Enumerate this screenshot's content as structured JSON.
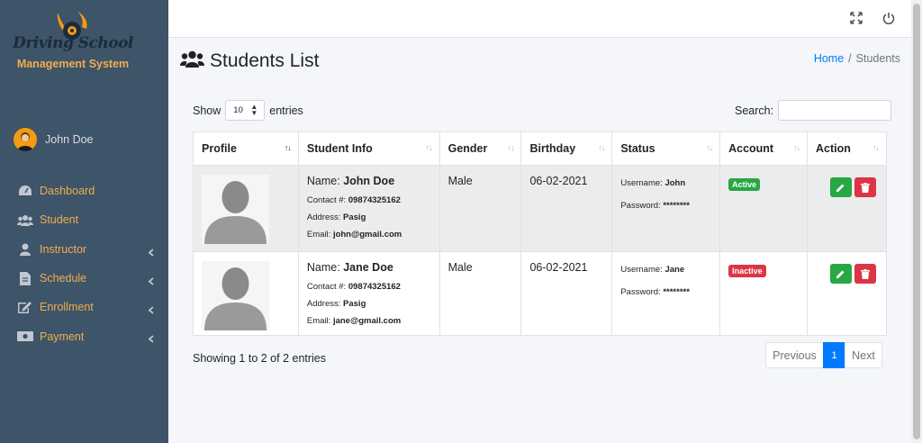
{
  "brand": {
    "title": "Driving School",
    "subtitle": "Management System"
  },
  "user": {
    "name": "John Doe"
  },
  "nav": [
    {
      "label": "Dashboard",
      "icon": "dashboard-icon",
      "has_caret": false
    },
    {
      "label": "Student",
      "icon": "users-icon",
      "has_caret": false
    },
    {
      "label": "Instructor",
      "icon": "user-icon",
      "has_caret": true
    },
    {
      "label": "Schedule",
      "icon": "file-icon",
      "has_caret": true
    },
    {
      "label": "Enrollment",
      "icon": "edit-icon",
      "has_caret": true
    },
    {
      "label": "Payment",
      "icon": "money-icon",
      "has_caret": true
    }
  ],
  "header": {
    "title": "Students List",
    "breadcrumb": {
      "home": "Home",
      "separator": "/",
      "current": "Students"
    }
  },
  "datatable": {
    "show_label": "Show",
    "entries_label": "entries",
    "page_length": "10",
    "search_label": "Search:",
    "search_value": "",
    "columns": [
      "Profile",
      "Student Info",
      "Gender",
      "Birthday",
      "Status",
      "Account",
      "Action"
    ],
    "rows": [
      {
        "name_label": "Name:",
        "name": "John Doe",
        "contact_label": "Contact #:",
        "contact": "09874325162",
        "address_label": "Address:",
        "address": "Pasig",
        "email_label": "Email:",
        "email": "john@gmail.com",
        "gender": "Male",
        "birthday": "06-02-2021",
        "username_label": "Username:",
        "username": "John",
        "password_label": "Password:",
        "password": "********",
        "account": "Active"
      },
      {
        "name_label": "Name:",
        "name": "Jane Doe",
        "contact_label": "Contact #:",
        "contact": "09874325162",
        "address_label": "Address:",
        "address": "Pasig",
        "email_label": "Email:",
        "email": "jane@gmail.com",
        "gender": "Male",
        "birthday": "06-02-2021",
        "username_label": "Username:",
        "username": "Jane",
        "password_label": "Password:",
        "password": "********",
        "account": "Inactive"
      }
    ],
    "info": "Showing 1 to 2 of 2 entries",
    "pagination": {
      "previous": "Previous",
      "current": "1",
      "next": "Next"
    }
  },
  "colors": {
    "sidebar_bg": "#3e5468",
    "nav_label": "#f0ad4e",
    "primary": "#007bff",
    "success": "#28a745",
    "danger": "#dc3545"
  }
}
